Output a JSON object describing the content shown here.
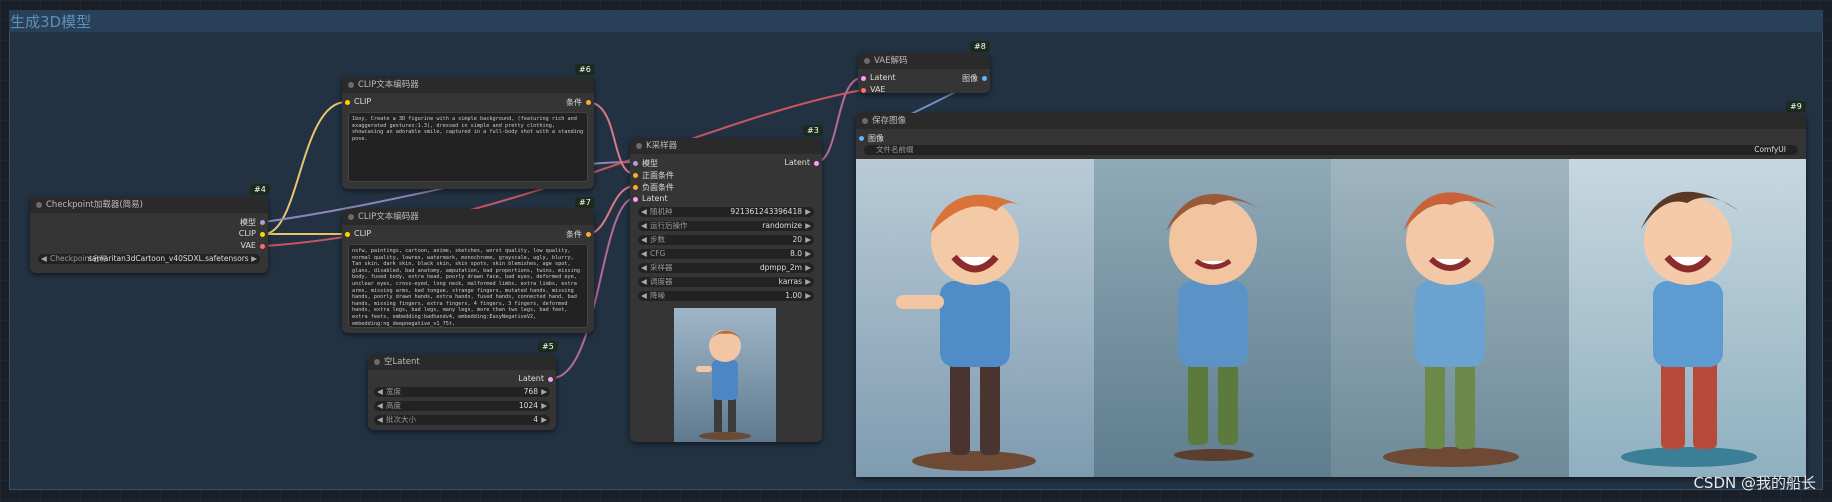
{
  "group": {
    "title": "生成3D模型"
  },
  "badges": {
    "n4": "#4",
    "n6": "#6",
    "n7": "#7",
    "n3": "#3",
    "n5": "#5",
    "n8": "#8",
    "n9": "#9"
  },
  "checkpoint": {
    "title": "Checkpoint加载器(简易)",
    "outputs": [
      "模型",
      "CLIP",
      "VAE"
    ],
    "ckpt_label": "Checkpoint名称",
    "ckpt_value": "samaritan3dCartoon_v40SDXL.safetensors"
  },
  "clip_pos": {
    "title": "CLIP文本编码器",
    "input": "CLIP",
    "output": "条件",
    "text": "1boy, Create a 3D figurine with a simple background, (featuring rich and exaggerated gestures:1.3), dressed in simple and pretty clothing, showcasing an adorable smile, captured in a full-body shot with a standing pose."
  },
  "clip_neg": {
    "title": "CLIP文本编码器",
    "input": "CLIP",
    "output": "条件",
    "text": "nsfw, paintings, cartoon, anime, sketches, worst quality, low quality, normal quality, lowres, watermark, monochrome, grayscale, ugly, blurry, Tan skin, dark skin, black skin, skin spots, skin blemishes, age spot, glans, disabled, bad anatomy, amputation, bad proportions, twins, missing body, fused body, extra head, poorly drawn face, bad eyes, deformed eye, unclear eyes, cross-eyed, long neck, malformed limbs, extra limbs, extra arms, missing arms, bad tongue, strange fingers, mutated hands, missing hands, poorly drawn hands, extra hands, fused hands, connected hand, bad hands, missing fingers, extra fingers, 4 fingers, 3 fingers, deformed hands, extra legs, bad legs, many legs, more than two legs, bad feet, extra feets, embedding:badhandv4, embedding:EasyNegativeV2, embedding:ng_deepnegative_v1_75t,"
  },
  "sampler": {
    "title": "K采样器",
    "inputs": [
      "模型",
      "正面条件",
      "负面条件",
      "Latent"
    ],
    "output": "Latent",
    "widgets": [
      {
        "label": "随机种",
        "value": "921361243396418"
      },
      {
        "label": "运行后操作",
        "value": "randomize"
      },
      {
        "label": "步数",
        "value": "20"
      },
      {
        "label": "CFG",
        "value": "8.0"
      },
      {
        "label": "采样器",
        "value": "dpmpp_2m"
      },
      {
        "label": "调度器",
        "value": "karras"
      },
      {
        "label": "降噪",
        "value": "1.00"
      }
    ]
  },
  "latent": {
    "title": "空Latent",
    "output": "Latent",
    "widgets": [
      {
        "label": "宽度",
        "value": "768"
      },
      {
        "label": "高度",
        "value": "1024"
      },
      {
        "label": "批次大小",
        "value": "4"
      }
    ]
  },
  "vae": {
    "title": "VAE解码",
    "inputs": [
      "Latent",
      "VAE"
    ],
    "output": "图像"
  },
  "save": {
    "title": "保存图像",
    "input": "图像",
    "prefix_label": "文件名前缀",
    "prefix_value": "ComfyUI"
  },
  "watermark": "CSDN @我的船长",
  "colors": {
    "clip": "#ffd500",
    "model": "#b39ddb",
    "vae": "#ff6e6e",
    "cond": "#ffa931",
    "latent": "#ff9cf9",
    "image": "#64b5f6"
  }
}
